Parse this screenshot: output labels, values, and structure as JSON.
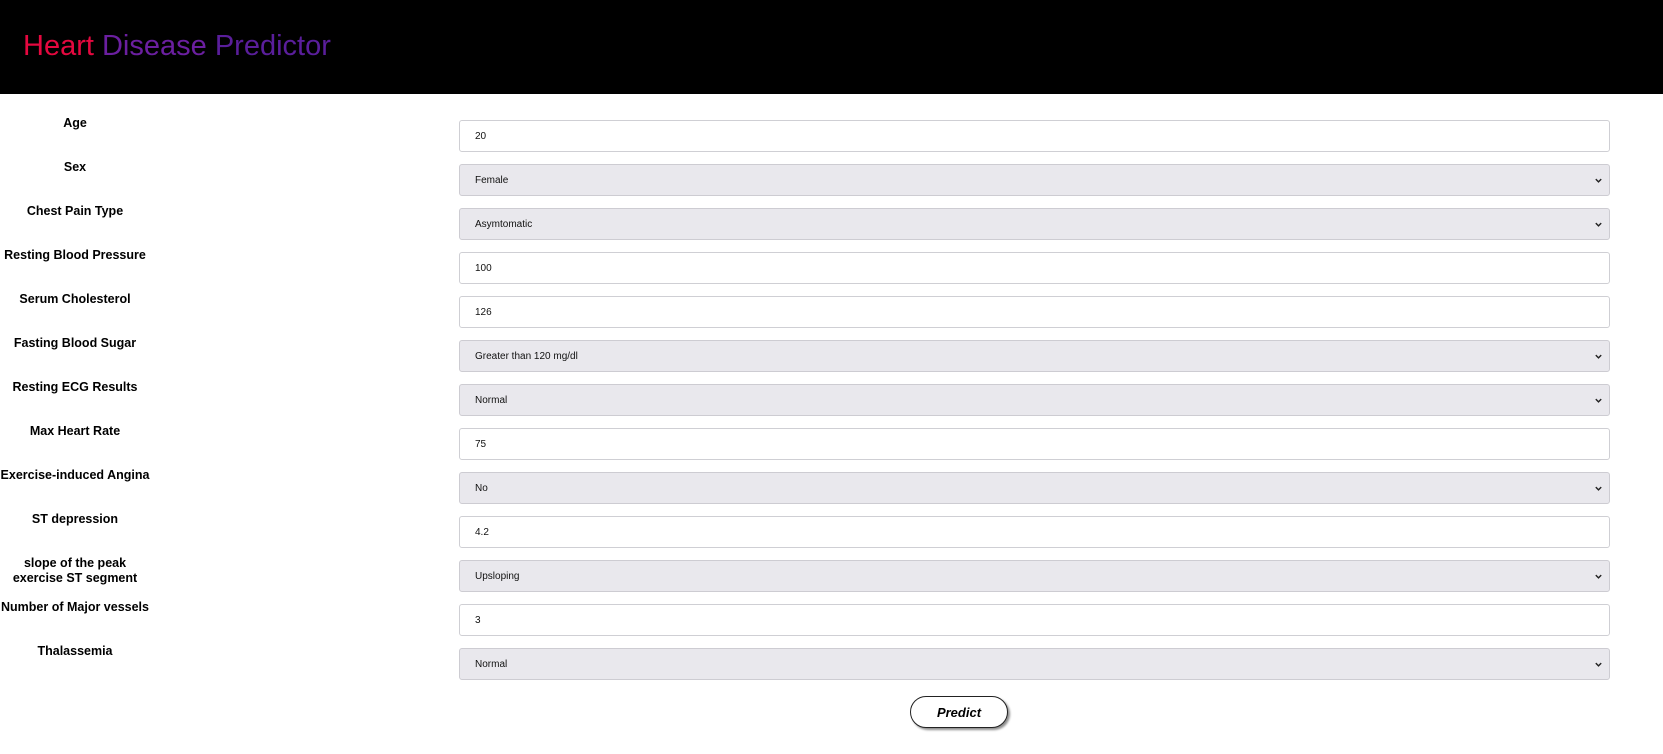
{
  "header": {
    "brand_word1": "Heart",
    "brand_word2": "Disease",
    "brand_word3": "Predictor",
    "colors": {
      "background": "#000000",
      "heart": "#e5083f",
      "rest": "#6b1fa0"
    }
  },
  "form": {
    "fields": [
      {
        "label": "Age",
        "type": "input",
        "value": "20"
      },
      {
        "label": "Sex",
        "type": "select",
        "value": "Female"
      },
      {
        "label": "Chest Pain Type",
        "type": "select",
        "value": "Asymtomatic"
      },
      {
        "label": "Resting Blood Pressure",
        "type": "input",
        "value": "100"
      },
      {
        "label": "Serum Cholesterol",
        "type": "input",
        "value": "126"
      },
      {
        "label": "Fasting Blood Sugar",
        "type": "select",
        "value": "Greater than 120 mg/dl"
      },
      {
        "label": "Resting ECG Results",
        "type": "select",
        "value": "Normal"
      },
      {
        "label": "Max Heart Rate",
        "type": "input",
        "value": "75"
      },
      {
        "label": "Exercise-induced Angina",
        "type": "select",
        "value": "No"
      },
      {
        "label": "ST depression",
        "type": "input",
        "value": "4.2"
      },
      {
        "label": "slope of the peak exercise ST segment",
        "type": "select",
        "value": "Upsloping"
      },
      {
        "label": "Number of Major vessels",
        "type": "input",
        "value": "3"
      },
      {
        "label": "Thalassemia",
        "type": "select",
        "value": "Normal"
      }
    ],
    "submit_label": "Predict"
  }
}
